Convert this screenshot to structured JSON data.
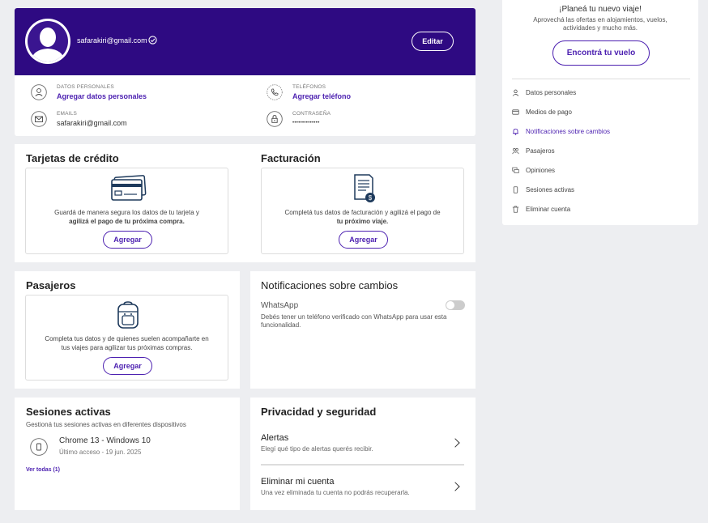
{
  "profile": {
    "email": "safarakiri@gmail.com",
    "edit_label": "Editar",
    "personal_label": "DATOS PERSONALES",
    "personal_value": "Agregar datos personales",
    "phone_label": "TELÉFONOS",
    "phone_value": "Agregar teléfono",
    "emails_label": "EMAILS",
    "emails_value": "safarakiri@gmail.com",
    "password_label": "CONTRASEÑA",
    "password_value": "••••••••••••••"
  },
  "credit_cards": {
    "title": "Tarjetas de crédito",
    "text_1": "Guardá de manera segura los datos de tu tarjeta y",
    "text_2": "agilizá el pago de tu próxima compra.",
    "button": "Agregar"
  },
  "billing": {
    "title": "Facturación",
    "text_1": "Completá tus datos de facturación y agilizá el pago de",
    "text_2": "tu próximo viaje.",
    "button": "Agregar"
  },
  "passengers": {
    "title": "Pasajeros",
    "text_1": "Completa tus datos y de quienes suelen acompañarte en",
    "text_2": "tus viajes para agilizar tus próximas compras.",
    "button": "Agregar"
  },
  "notifications": {
    "title": "Notificaciones sobre cambios",
    "whatsapp_label": "WhatsApp",
    "whatsapp_note": "Debés tener un teléfono verificado con WhatsApp para usar esta funcionalidad.",
    "whatsapp_enabled": false
  },
  "sessions": {
    "title": "Sesiones activas",
    "subtitle": "Gestioná tus sesiones activas en diferentes dispositivos",
    "device": "Chrome 13 - Windows 10",
    "last_access": "Último acceso - 19 jun. 2025",
    "view_all": "Ver todas (1)"
  },
  "privacy": {
    "title": "Privacidad y seguridad",
    "alerts_title": "Alertas",
    "alerts_desc": "Elegí qué tipo de alertas querés recibir.",
    "delete_title": "Eliminar mi cuenta",
    "delete_desc": "Una vez eliminada tu cuenta no podrás recuperarla."
  },
  "sidebar": {
    "promo_title": "¡Planeá tu nuevo viaje!",
    "promo_text": "Aprovechá las ofertas en alojamientos, vuelos, actividades y mucho más.",
    "promo_button": "Encontrá tu vuelo",
    "items": [
      {
        "label": "Datos personales",
        "icon": "user-icon"
      },
      {
        "label": "Medios de pago",
        "icon": "card-icon"
      },
      {
        "label": "Notificaciones sobre cambios",
        "icon": "bell-icon"
      },
      {
        "label": "Pasajeros",
        "icon": "group-icon"
      },
      {
        "label": "Opiniones",
        "icon": "chat-icon"
      },
      {
        "label": "Sesiones activas",
        "icon": "device-icon"
      },
      {
        "label": "Eliminar cuenta",
        "icon": "trash-icon"
      }
    ]
  },
  "colors": {
    "brand": "#2e0a82",
    "accent": "#4b1fb0"
  }
}
